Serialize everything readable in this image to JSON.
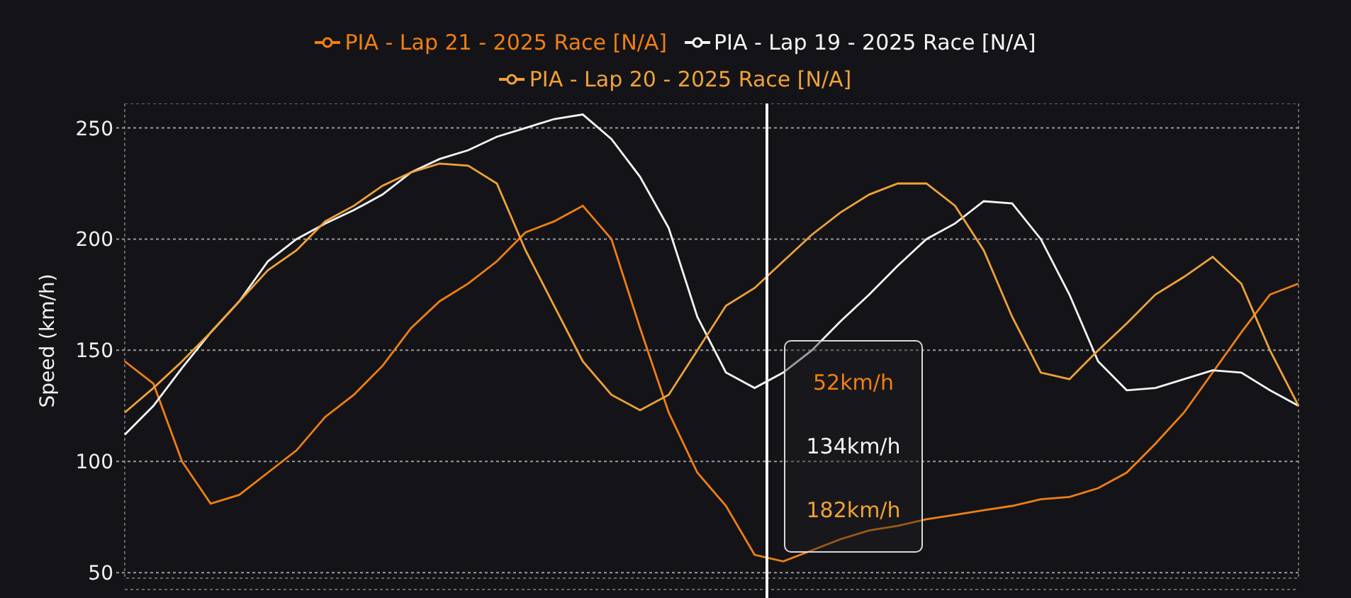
{
  "chart": {
    "chart_data": {
      "type": "line",
      "ylabel": "Speed (km/h)",
      "grid": true,
      "ylim": [
        47.5,
        261
      ],
      "yticks": [
        50,
        100,
        150,
        200,
        250
      ],
      "series": [
        {
          "name": "PIA - Lap 21 - 2025 Race [N/A]",
          "color": "#f07f13",
          "values": [
            145,
            135,
            100,
            81,
            85,
            95,
            105,
            120,
            130,
            143,
            160,
            172,
            180,
            190,
            203,
            208,
            215,
            200,
            160,
            122,
            95,
            80,
            58,
            55,
            60,
            65,
            69,
            71,
            74,
            76,
            78,
            80,
            83,
            84,
            88,
            95,
            108,
            122,
            140,
            158,
            175,
            180
          ]
        },
        {
          "name": "PIA - Lap 19 - 2025 Race [N/A]",
          "color": "#f4f4f4",
          "values": [
            112,
            125,
            142,
            158,
            172,
            190,
            200,
            207,
            213,
            220,
            230,
            236,
            240,
            246,
            250,
            254,
            256,
            245,
            228,
            205,
            165,
            140,
            133,
            140,
            150,
            163,
            175,
            188,
            200,
            207,
            217,
            216,
            200,
            175,
            145,
            132,
            133,
            137,
            141,
            140,
            132,
            125
          ]
        },
        {
          "name": "PIA - Lap 20 - 2025 Race [N/A]",
          "color": "#efa238",
          "values": [
            122,
            133,
            145,
            158,
            172,
            186,
            195,
            208,
            215,
            224,
            230,
            234,
            233,
            225,
            195,
            170,
            145,
            130,
            123,
            130,
            150,
            170,
            178,
            190,
            202,
            212,
            220,
            225,
            225,
            215,
            195,
            165,
            140,
            137,
            150,
            162,
            175,
            183,
            192,
            180,
            150,
            125
          ]
        }
      ]
    },
    "tooltip": {
      "items": [
        {
          "text": "52km/h",
          "color": "#f07f13"
        },
        {
          "text": "134km/h",
          "color": "#f4f4f4"
        },
        {
          "text": "182km/h",
          "color": "#efa238"
        }
      ]
    }
  }
}
